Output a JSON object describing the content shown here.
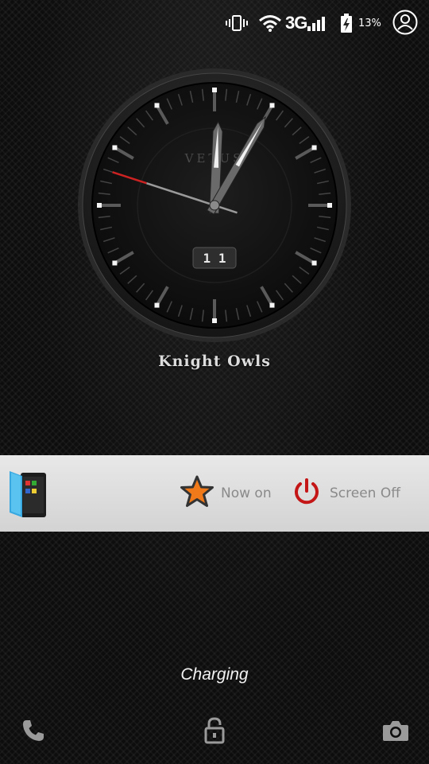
{
  "status_bar": {
    "icons": [
      "vibrate-icon",
      "wifi-icon",
      "signal-icon",
      "battery-charging-icon",
      "profile-icon"
    ],
    "network_type": "3G",
    "battery_percent": "13%"
  },
  "clock": {
    "brand": "VETUS",
    "date_display": "1 1",
    "time": "12:05",
    "accent_color": "#cc2222"
  },
  "owner_info": "Knight Owls",
  "widget": {
    "now_on_label": "Now on",
    "screen_off_label": "Screen Off",
    "icons": [
      "tablet-app-icon",
      "star-icon",
      "power-icon"
    ],
    "power_color": "#c41616",
    "star_color": "#f07a1a"
  },
  "charging_text": "Charging",
  "bottom_bar": {
    "icons": [
      "phone-icon",
      "unlock-icon",
      "camera-icon"
    ]
  }
}
